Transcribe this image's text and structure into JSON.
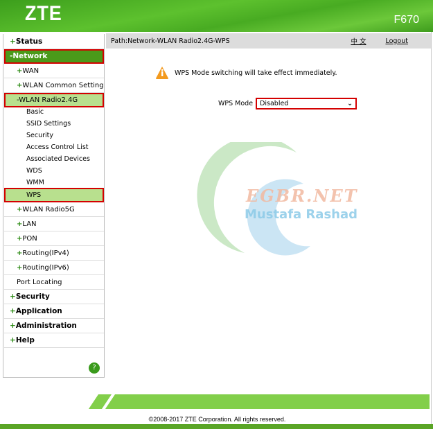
{
  "header": {
    "logo": "ZTE",
    "model": "F670"
  },
  "path": "Path:Network-WLAN Radio2.4G-WPS",
  "language_link": "中 文",
  "logout": "Logout",
  "notice": "WPS Mode switching will take effect immediately.",
  "wps_mode": {
    "label": "WPS Mode",
    "value": "Disabled"
  },
  "sidebar": {
    "status": "Status",
    "network": "-Network",
    "wan": "WAN",
    "wlan_common": "WLAN Common Setting",
    "wlan24": "-WLAN Radio2.4G",
    "sub": [
      "Basic",
      "SSID Settings",
      "Security",
      "Access Control List",
      "Associated Devices",
      "WDS",
      "WMM",
      "WPS"
    ],
    "wlan5": "WLAN Radio5G",
    "lan": "LAN",
    "pon": "PON",
    "routing4": "Routing(IPv4)",
    "routing6": "Routing(IPv6)",
    "port": "Port Locating",
    "security": "Security",
    "application": "Application",
    "administration": "Administration",
    "help": "Help",
    "help_icon": "?"
  },
  "watermark": {
    "line1": "EGBR.NET",
    "line2": "Mustafa Rashad"
  },
  "footer": {
    "copyright": "©2008-2017 ZTE Corporation. All rights reserved."
  },
  "colors": {
    "brand_green": "#4a9a1a",
    "highlight_red": "#d40000",
    "selected_light": "#b8e08e"
  }
}
